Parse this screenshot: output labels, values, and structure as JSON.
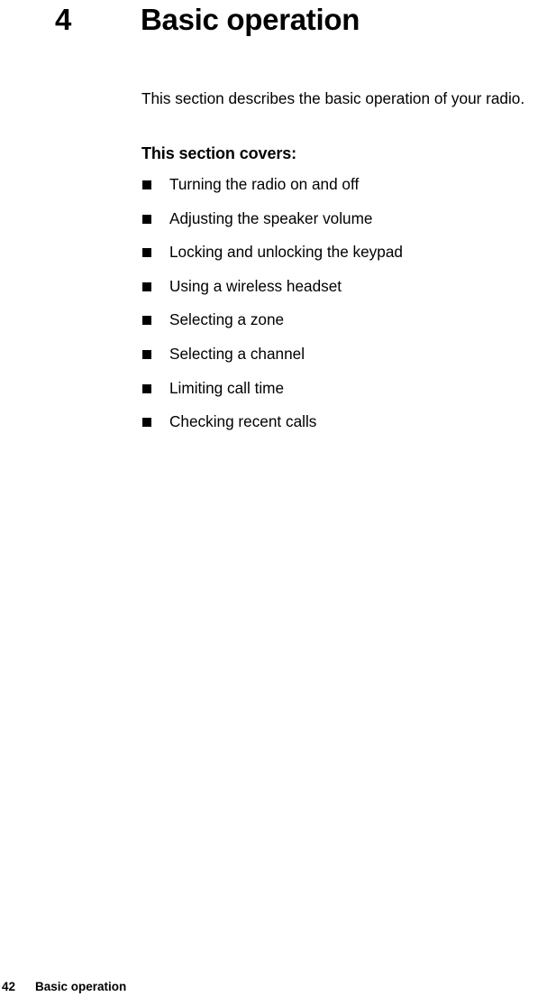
{
  "chapter": {
    "number": "4",
    "title": "Basic operation"
  },
  "intro": {
    "paragraph": "This section describes the basic operation of your radio."
  },
  "section": {
    "heading": "This section covers:",
    "bullets": [
      {
        "label": "Turning the radio on and off"
      },
      {
        "label": "Adjusting the speaker volume"
      },
      {
        "label": "Locking and unlocking the keypad"
      },
      {
        "label": "Using a wireless headset"
      },
      {
        "label": "Selecting a zone"
      },
      {
        "label": "Selecting a channel"
      },
      {
        "label": "Limiting call time"
      },
      {
        "label": "Checking recent calls"
      }
    ],
    "bullet_marker": "filled-square-bullet-icon"
  },
  "footer": {
    "page_number": "42",
    "section_name": "Basic operation"
  },
  "colors": {
    "text": "#000000",
    "background": "#ffffff",
    "bullet": "#000000"
  }
}
